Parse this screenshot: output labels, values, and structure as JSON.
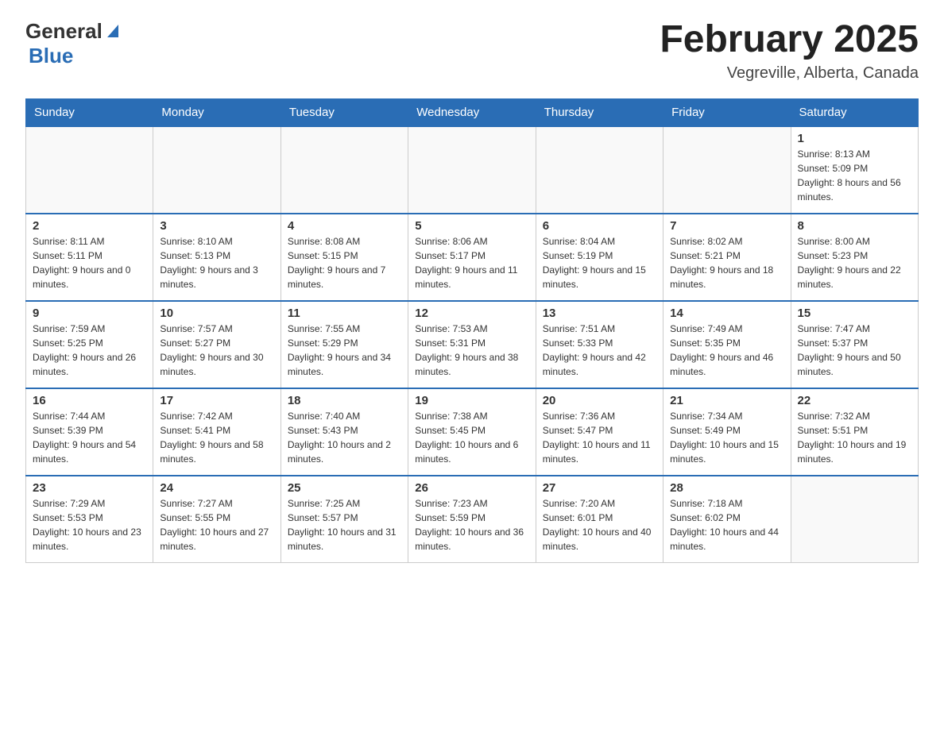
{
  "header": {
    "logo_general": "General",
    "logo_blue": "Blue",
    "month_title": "February 2025",
    "location": "Vegreville, Alberta, Canada"
  },
  "days_of_week": [
    "Sunday",
    "Monday",
    "Tuesday",
    "Wednesday",
    "Thursday",
    "Friday",
    "Saturday"
  ],
  "weeks": [
    [
      {
        "day": "",
        "info": ""
      },
      {
        "day": "",
        "info": ""
      },
      {
        "day": "",
        "info": ""
      },
      {
        "day": "",
        "info": ""
      },
      {
        "day": "",
        "info": ""
      },
      {
        "day": "",
        "info": ""
      },
      {
        "day": "1",
        "info": "Sunrise: 8:13 AM\nSunset: 5:09 PM\nDaylight: 8 hours and 56 minutes."
      }
    ],
    [
      {
        "day": "2",
        "info": "Sunrise: 8:11 AM\nSunset: 5:11 PM\nDaylight: 9 hours and 0 minutes."
      },
      {
        "day": "3",
        "info": "Sunrise: 8:10 AM\nSunset: 5:13 PM\nDaylight: 9 hours and 3 minutes."
      },
      {
        "day": "4",
        "info": "Sunrise: 8:08 AM\nSunset: 5:15 PM\nDaylight: 9 hours and 7 minutes."
      },
      {
        "day": "5",
        "info": "Sunrise: 8:06 AM\nSunset: 5:17 PM\nDaylight: 9 hours and 11 minutes."
      },
      {
        "day": "6",
        "info": "Sunrise: 8:04 AM\nSunset: 5:19 PM\nDaylight: 9 hours and 15 minutes."
      },
      {
        "day": "7",
        "info": "Sunrise: 8:02 AM\nSunset: 5:21 PM\nDaylight: 9 hours and 18 minutes."
      },
      {
        "day": "8",
        "info": "Sunrise: 8:00 AM\nSunset: 5:23 PM\nDaylight: 9 hours and 22 minutes."
      }
    ],
    [
      {
        "day": "9",
        "info": "Sunrise: 7:59 AM\nSunset: 5:25 PM\nDaylight: 9 hours and 26 minutes."
      },
      {
        "day": "10",
        "info": "Sunrise: 7:57 AM\nSunset: 5:27 PM\nDaylight: 9 hours and 30 minutes."
      },
      {
        "day": "11",
        "info": "Sunrise: 7:55 AM\nSunset: 5:29 PM\nDaylight: 9 hours and 34 minutes."
      },
      {
        "day": "12",
        "info": "Sunrise: 7:53 AM\nSunset: 5:31 PM\nDaylight: 9 hours and 38 minutes."
      },
      {
        "day": "13",
        "info": "Sunrise: 7:51 AM\nSunset: 5:33 PM\nDaylight: 9 hours and 42 minutes."
      },
      {
        "day": "14",
        "info": "Sunrise: 7:49 AM\nSunset: 5:35 PM\nDaylight: 9 hours and 46 minutes."
      },
      {
        "day": "15",
        "info": "Sunrise: 7:47 AM\nSunset: 5:37 PM\nDaylight: 9 hours and 50 minutes."
      }
    ],
    [
      {
        "day": "16",
        "info": "Sunrise: 7:44 AM\nSunset: 5:39 PM\nDaylight: 9 hours and 54 minutes."
      },
      {
        "day": "17",
        "info": "Sunrise: 7:42 AM\nSunset: 5:41 PM\nDaylight: 9 hours and 58 minutes."
      },
      {
        "day": "18",
        "info": "Sunrise: 7:40 AM\nSunset: 5:43 PM\nDaylight: 10 hours and 2 minutes."
      },
      {
        "day": "19",
        "info": "Sunrise: 7:38 AM\nSunset: 5:45 PM\nDaylight: 10 hours and 6 minutes."
      },
      {
        "day": "20",
        "info": "Sunrise: 7:36 AM\nSunset: 5:47 PM\nDaylight: 10 hours and 11 minutes."
      },
      {
        "day": "21",
        "info": "Sunrise: 7:34 AM\nSunset: 5:49 PM\nDaylight: 10 hours and 15 minutes."
      },
      {
        "day": "22",
        "info": "Sunrise: 7:32 AM\nSunset: 5:51 PM\nDaylight: 10 hours and 19 minutes."
      }
    ],
    [
      {
        "day": "23",
        "info": "Sunrise: 7:29 AM\nSunset: 5:53 PM\nDaylight: 10 hours and 23 minutes."
      },
      {
        "day": "24",
        "info": "Sunrise: 7:27 AM\nSunset: 5:55 PM\nDaylight: 10 hours and 27 minutes."
      },
      {
        "day": "25",
        "info": "Sunrise: 7:25 AM\nSunset: 5:57 PM\nDaylight: 10 hours and 31 minutes."
      },
      {
        "day": "26",
        "info": "Sunrise: 7:23 AM\nSunset: 5:59 PM\nDaylight: 10 hours and 36 minutes."
      },
      {
        "day": "27",
        "info": "Sunrise: 7:20 AM\nSunset: 6:01 PM\nDaylight: 10 hours and 40 minutes."
      },
      {
        "day": "28",
        "info": "Sunrise: 7:18 AM\nSunset: 6:02 PM\nDaylight: 10 hours and 44 minutes."
      },
      {
        "day": "",
        "info": ""
      }
    ]
  ]
}
